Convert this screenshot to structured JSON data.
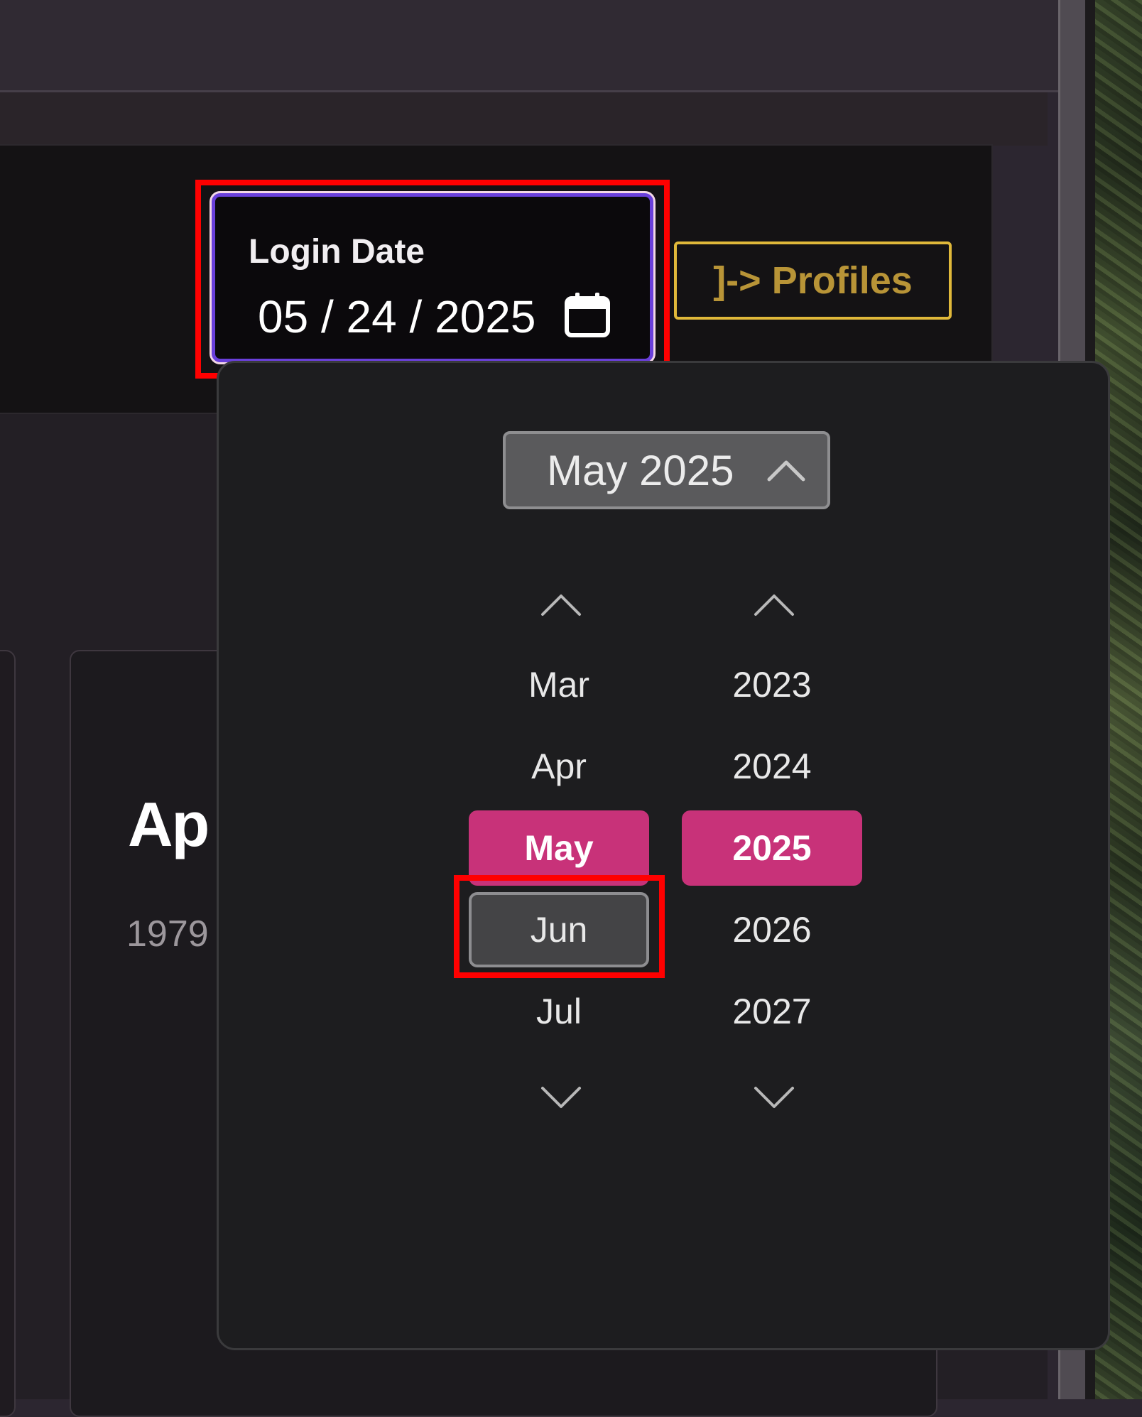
{
  "login_date": {
    "label": "Login Date",
    "value": "05 / 24 / 2025"
  },
  "profiles_button": {
    "label": "]-> Profiles"
  },
  "app_card": {
    "title": "Ap",
    "subtitle": "1979"
  },
  "picker": {
    "header_label": "May 2025",
    "months": [
      "Mar",
      "Apr",
      "May",
      "Jun",
      "Jul"
    ],
    "years": [
      "2023",
      "2024",
      "2025",
      "2026",
      "2027"
    ],
    "selected_month": "May",
    "selected_year": "2025",
    "focused_month": "Jun"
  },
  "colors": {
    "accent_selected": "#c83279",
    "focus_ring": "#6a3fdb",
    "profiles_gold": "#b89437",
    "annotation_red": "#ff0000"
  },
  "icons": {
    "field": "calendar-icon",
    "toggle": "chevron-up-icon",
    "scroll_up": "chevron-up-icon",
    "scroll_down": "chevron-down-icon"
  }
}
